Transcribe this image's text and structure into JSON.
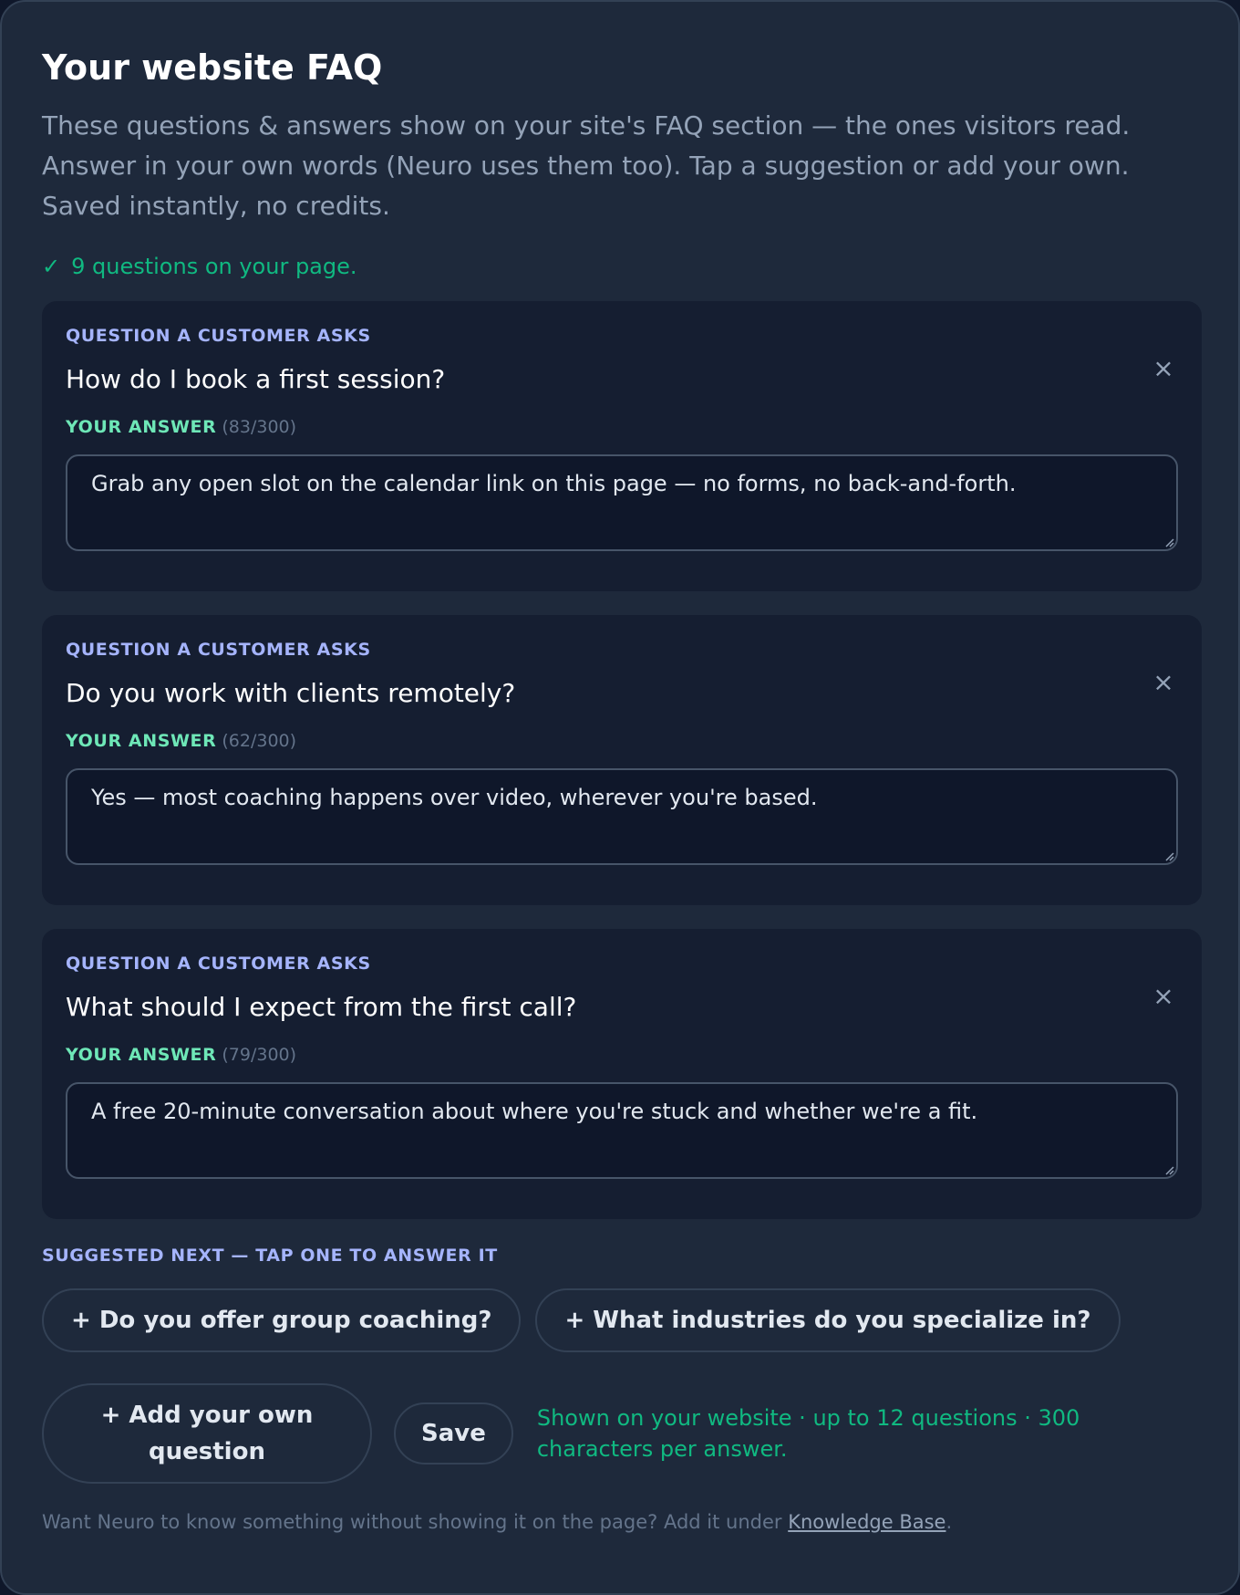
{
  "header": {
    "title": "Your website FAQ",
    "intro": "These questions & answers show on your site's FAQ section — the ones visitors read. Answer in your own words (Neuro uses them too). Tap a suggestion or add your own. Saved instantly, no credits."
  },
  "status": {
    "check": "✓",
    "text": "9 questions on your page."
  },
  "faq": [
    {
      "question_label": "QUESTION A CUSTOMER ASKS",
      "question": "How do I book a first session?",
      "answer_label": "YOUR ANSWER",
      "count": "(83/300)",
      "answer": "Grab any open slot on the calendar link on this page — no forms, no back-and-forth.",
      "close": "×"
    },
    {
      "question_label": "QUESTION A CUSTOMER ASKS",
      "question": "Do you work with clients remotely?",
      "answer_label": "YOUR ANSWER",
      "count": "(62/300)",
      "answer": "Yes — most coaching happens over video, wherever you're based.",
      "close": "×"
    },
    {
      "question_label": "QUESTION A CUSTOMER ASKS",
      "question": "What should I expect from the first call?",
      "answer_label": "YOUR ANSWER",
      "count": "(79/300)",
      "answer": "A free 20-minute conversation about where you're stuck and whether we're a fit.",
      "close": "×"
    }
  ],
  "suggestions": {
    "label": "SUGGESTED NEXT — TAP ONE TO ANSWER IT",
    "items": [
      "+ Do you offer group coaching?",
      "+ What industries do you specialize in?"
    ]
  },
  "actions": {
    "add_label": "+ Add your own question",
    "save_label": "Save",
    "note": "Shown on your website · up to 12 questions · 300 characters per answer."
  },
  "footer": {
    "text": "Want Neuro to know something without showing it on the page? Add it under ",
    "link": "Knowledge Base",
    "end": "."
  },
  "colors": {
    "panel_bg": "#1e293b",
    "card_bg": "#151e31",
    "accent_green": "#10b981",
    "accent_indigo": "#a5b4fc"
  }
}
